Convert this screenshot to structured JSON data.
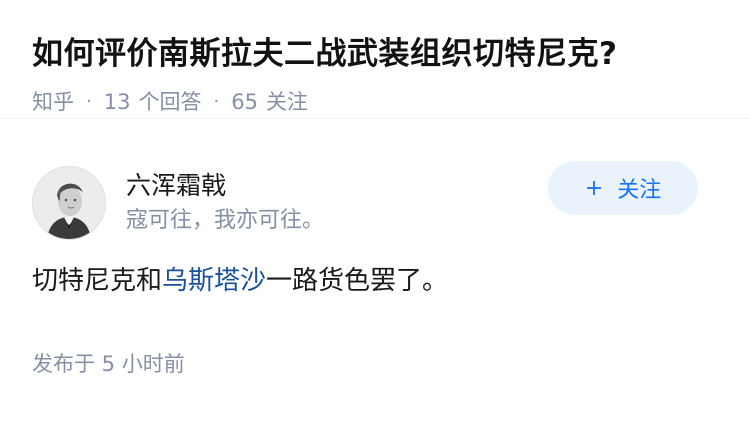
{
  "question": {
    "title": "如何评价南斯拉夫二战武装组织切特尼克?",
    "source": "知乎",
    "answer_count": "13",
    "answer_label": "个回答",
    "follow_count": "65",
    "follow_label": "关注"
  },
  "answer": {
    "author": {
      "name": "六浑霜戟",
      "bio": "寇可往，我亦可往。"
    },
    "follow_button": {
      "icon": "+",
      "label": "关注"
    },
    "content": {
      "before": "切特尼克和",
      "link": "乌斯塔沙",
      "after": "一路货色罢了。"
    },
    "time": "发布于  5 小时前"
  },
  "colors": {
    "link": "#175199",
    "follow_text": "#1772f6",
    "follow_bg": "#eaf2fb",
    "meta": "#8590a6"
  }
}
